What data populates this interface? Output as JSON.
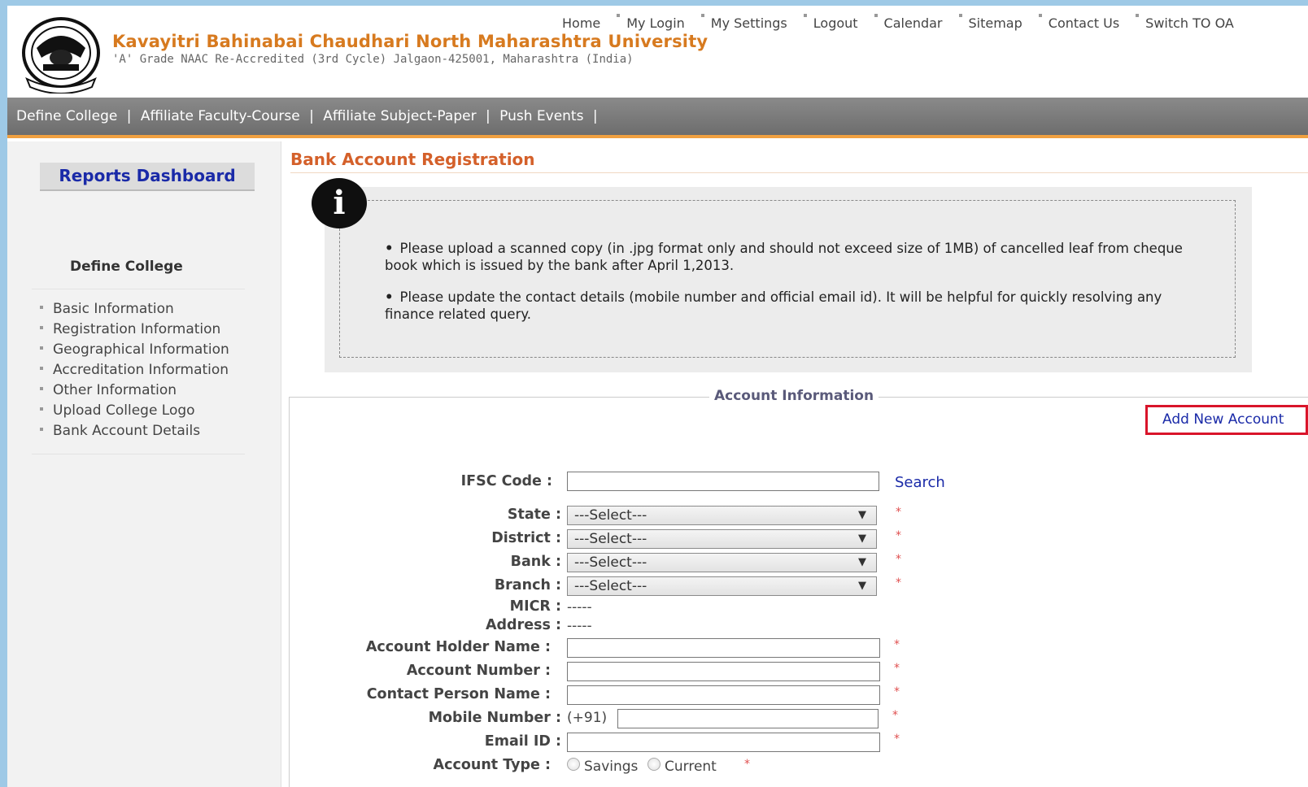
{
  "header": {
    "university_name": "Kavayitri Bahinabai Chaudhari North Maharashtra University",
    "university_sub": "'A' Grade NAAC Re-Accredited (3rd Cycle) Jalgaon-425001, Maharashtra (India)",
    "top_links": [
      "Home",
      "My Login",
      "My Settings",
      "Logout",
      "Calendar",
      "Sitemap",
      "Contact Us",
      "Switch TO OA"
    ]
  },
  "nav": {
    "items": [
      "Define College",
      "Affiliate Faculty-Course",
      "Affiliate Subject-Paper",
      "Push Events"
    ],
    "separator": "|"
  },
  "sidebar": {
    "dashboard_label": "Reports Dashboard",
    "section_title": "Define College",
    "items": [
      "Basic Information",
      "Registration Information",
      "Geographical Information",
      "Accreditation Information",
      "Other Information",
      "Upload College Logo",
      "Bank Account Details"
    ]
  },
  "main": {
    "page_title": "Bank Account Registration",
    "info_icon": "i",
    "notes": [
      "Please upload a scanned copy (in .jpg format only and should not exceed size of 1MB) of cancelled leaf from cheque book which is issued by the bank after April 1,2013.",
      "Please update the contact details (mobile number and official email id). It will be helpful for quickly resolving any finance related query."
    ]
  },
  "form": {
    "legend": "Account Information",
    "add_new_account": "Add New Account",
    "ifsc_label": "IFSC Code :",
    "search_label": "Search",
    "state_label": "State :",
    "district_label": "District :",
    "bank_label": "Bank :",
    "branch_label": "Branch :",
    "select_placeholder": "---Select---",
    "micr_label": "MICR :",
    "micr_value": "-----",
    "address_label": "Address :",
    "address_value": "-----",
    "holder_label": "Account Holder Name :",
    "number_label": "Account Number :",
    "contact_label": "Contact Person Name :",
    "mobile_label": "Mobile Number :",
    "mobile_prefix": "(+91)",
    "email_label": "Email ID :",
    "type_label": "Account Type :",
    "type_options": [
      "Savings",
      "Current"
    ],
    "required_mark": "*"
  }
}
